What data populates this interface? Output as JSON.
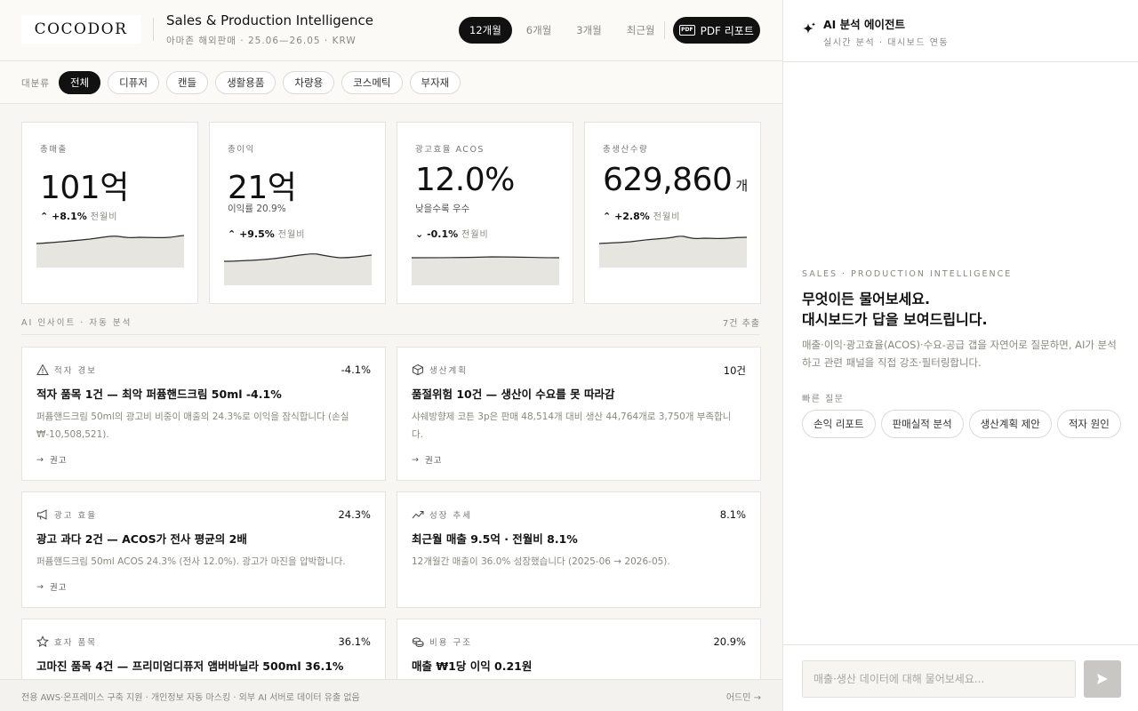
{
  "header": {
    "logo": "COCODOR",
    "title": "Sales & Production Intelligence",
    "subtitle": "아마존 해외판매 · 25.06—26.05 · KRW",
    "periods": [
      "12개월",
      "6개월",
      "3개월",
      "최근월"
    ],
    "pdf_label": "PDF 리포트",
    "pdf_icon_text": "PDF"
  },
  "filters": {
    "label": "대분류",
    "chips": [
      "전체",
      "디퓨저",
      "캔들",
      "생활용품",
      "차량용",
      "코스메틱",
      "부자재"
    ]
  },
  "kpis": [
    {
      "label": "총매출",
      "value": "101억",
      "unit": "",
      "sub": "",
      "delta": "+8.1%",
      "delta_note": "전월비",
      "direction": "up"
    },
    {
      "label": "총이익",
      "value": "21억",
      "unit": "",
      "sub": "이익률 20.9%",
      "delta": "+9.5%",
      "delta_note": "전월비",
      "direction": "up"
    },
    {
      "label": "광고효율 ACOS",
      "value": "12.0%",
      "unit": "",
      "sub": "낮을수록 우수",
      "delta": "-0.1%",
      "delta_note": "전월비",
      "direction": "down"
    },
    {
      "label": "총생산수량",
      "value": "629,860",
      "unit": "개",
      "sub": "",
      "delta": "+2.8%",
      "delta_note": "전월비",
      "direction": "up"
    }
  ],
  "insights_header": {
    "title": "AI 인사이트 · 자동 분석",
    "count": "7건 추출"
  },
  "insights": [
    {
      "category": "적자 경보",
      "icon": "warning-icon",
      "metric": "-4.1%",
      "title": "적자 품목 1건 — 최악 퍼퓸핸드크림 50ml -4.1%",
      "desc": "퍼퓸핸드크림 50ml의 광고비 비중이 매출의 24.3%로 이익을 잠식합니다 (손실 ₩-10,508,521).",
      "action": "권고"
    },
    {
      "category": "생산계획",
      "icon": "box-icon",
      "metric": "10건",
      "title": "품절위험 10건 — 생산이 수요를 못 따라감",
      "desc": "샤쉐방향제 코튼 3p은 판매 48,514개 대비 생산 44,764개로 3,750개 부족합니다.",
      "action": "권고"
    },
    {
      "category": "광고 효율",
      "icon": "megaphone-icon",
      "metric": "24.3%",
      "title": "광고 과다 2건 — ACOS가 전사 평균의 2배",
      "desc": "퍼퓸핸드크림 50ml ACOS 24.3% (전사 12.0%). 광고가 마진을 압박합니다.",
      "action": "권고"
    },
    {
      "category": "성장 추세",
      "icon": "trend-up-icon",
      "metric": "8.1%",
      "title": "최근월 매출 9.5억 · 전월비 8.1%",
      "desc": "12개월간 매출이 36.0% 성장했습니다 (2025-06 → 2026-05).",
      "action": ""
    },
    {
      "category": "효자 품목",
      "icon": "star-icon",
      "metric": "36.1%",
      "title": "고마진 품목 4건 — 프리미엄디퓨저 앰버바닐라 500ml 36.1%",
      "desc": "",
      "action": ""
    },
    {
      "category": "비용 구조",
      "icon": "coins-icon",
      "metric": "20.9%",
      "title": "매출 ₩1당 이익 0.21원",
      "desc": "",
      "action": ""
    }
  ],
  "footer": {
    "text": "전용 AWS·온프레미스 구축 지원 · 개인정보 자동 마스킹 · 외부 AI 서버로 데이터 유출 없음",
    "link": "어드민 →"
  },
  "panel": {
    "title": "AI 분석 에이전트",
    "subtitle": "실시간 분석 · 대시보드 연동",
    "eyebrow": "SALES · PRODUCTION INTELLIGENCE",
    "headline_1": "무엇이든 물어보세요.",
    "headline_2": "대시보드가 답을 보여드립니다.",
    "intro": "매출·이익·광고효율(ACOS)·수요-공급 갭을 자연어로 질문하면, AI가 분석하고 관련 패널을 직접 강조·필터링합니다.",
    "quick_label": "빠른 질문",
    "quick": [
      "손익 리포트",
      "판매실적 분석",
      "생산계획 제안",
      "적자 원인"
    ],
    "input_placeholder": "매출·생산 데이터에 대해 물어보세요..."
  },
  "colors": {
    "accent": "#111111",
    "spark_fill": "#e7e5df",
    "spark_line": "#2a2a2a",
    "send_disabled": "#c8c7c3"
  }
}
